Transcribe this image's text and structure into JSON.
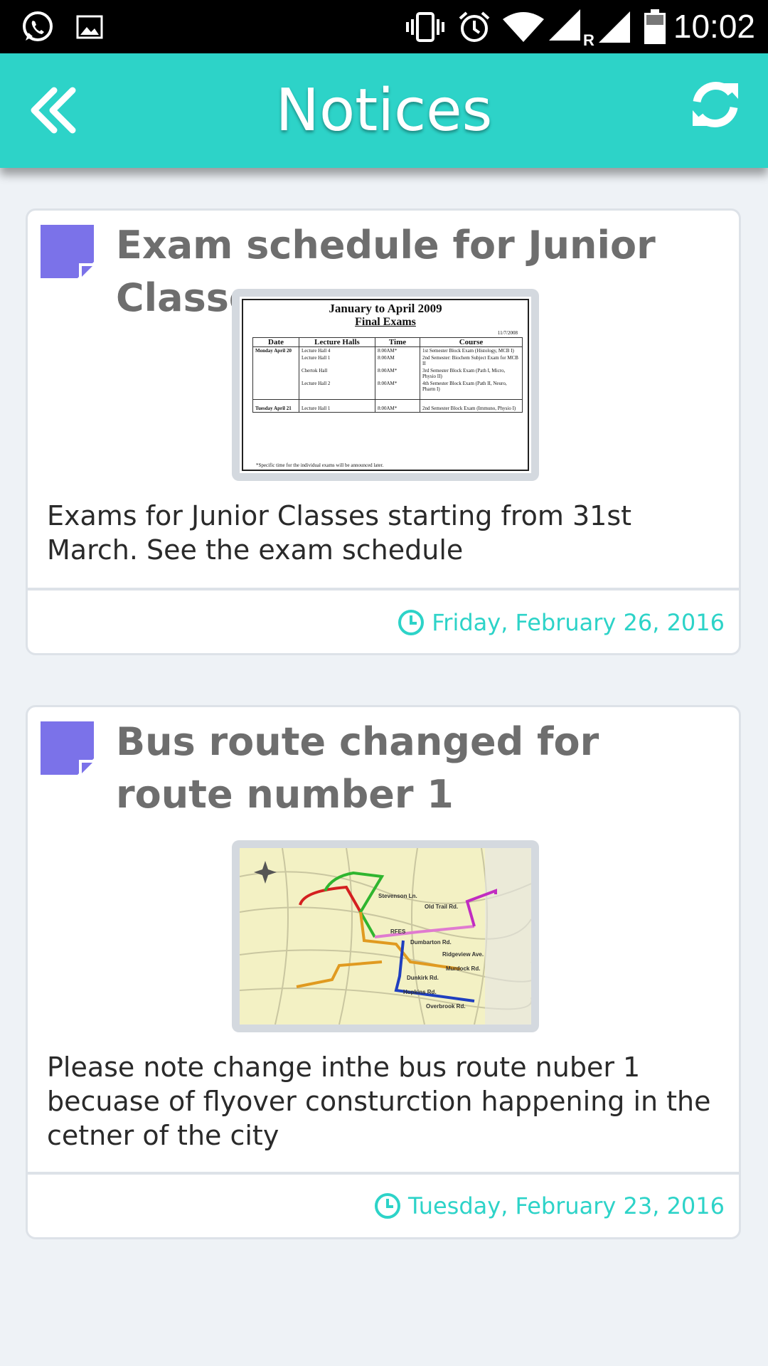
{
  "status_bar": {
    "time": "10:02",
    "icons": [
      "whatsapp-icon",
      "image-icon",
      "vibrate-icon",
      "alarm-icon",
      "wifi-icon",
      "signal-roaming-icon",
      "signal-icon",
      "battery-icon"
    ],
    "roaming_label": "R"
  },
  "app_bar": {
    "title": "Notices",
    "background": "#2dd3c8",
    "back_icon": "double-chevron-left-icon",
    "refresh_icon": "refresh-icon"
  },
  "notices": [
    {
      "title": "Exam schedule for Junior Classes",
      "body": "Exams for Junior Classes starting from 31st March. See the exam schedule",
      "date": "Friday, February 26, 2016",
      "image": {
        "heading": "January to April 2009",
        "subheading": "Final Exams",
        "doc_date": "11/7/2008",
        "columns": [
          "Date",
          "Lecture Halls",
          "Time",
          "Course"
        ],
        "rows": [
          [
            "Monday April 20",
            "Lecture Hall 4",
            "8:00AM*",
            "1st Semester Block Exam (Histology, MCB I)"
          ],
          [
            "",
            "Lecture Hall 1",
            "8:00AM",
            "2nd Semester: Biochem Subject Exam for MCB II"
          ],
          [
            "",
            "Chertok Hall",
            "8:00AM*",
            "3rd Semester Block Exam (Path I, Micro, Physio II)"
          ],
          [
            "",
            "Lecture Hall 2",
            "8:00AM*",
            "4th Semester Block Exam (Path II, Neuro, Pharm I)"
          ],
          [
            "Tuesday April 21",
            "Lecture Hall 1",
            "8:00AM*",
            "2nd Semester Block Exam (Immuno, Physio I)"
          ]
        ],
        "footnote": "*Specific time for the individual exams will be announced later."
      }
    },
    {
      "title": "Bus route changed for route number 1",
      "body": "Please note change inthe bus route nuber 1 becuase of flyover consturction happening in the cetner of the city",
      "date": "Tuesday, February 23, 2016",
      "image": {
        "type": "route-map",
        "labels": [
          "Stevenson Ln.",
          "Old Trail Rd.",
          "Dumbarton Rd.",
          "Ridgeview Ave.",
          "Murdock Rd.",
          "Dunkirk Rd.",
          "Hopkins Rd.",
          "Overbrook Rd.",
          "RFES"
        ],
        "route_colors": [
          "#2fb52f",
          "#d42020",
          "#e07bd0",
          "#e09a20",
          "#1f3fbf",
          "#c12cc1"
        ]
      }
    }
  ],
  "accent_color": "#2dd3c8",
  "note_icon_color": "#7b72e9"
}
